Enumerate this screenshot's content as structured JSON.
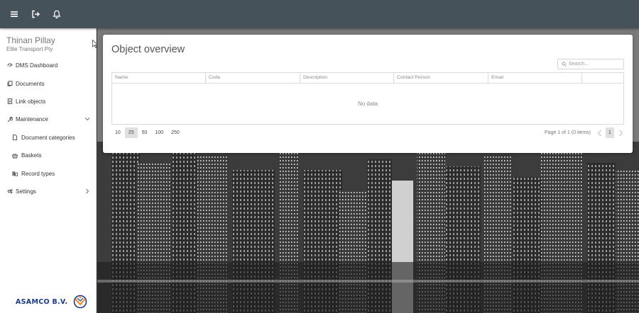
{
  "topbar": {
    "icons": [
      "menu-icon",
      "logout-icon",
      "bell-icon"
    ]
  },
  "user": {
    "name": "Thinan Pillay",
    "company": "Elite Transport Pty"
  },
  "nav": [
    {
      "label": "DMS Dashboard",
      "icon": "dashboard-icon"
    },
    {
      "label": "Documents",
      "icon": "documents-icon"
    },
    {
      "label": "Link objects",
      "icon": "link-objects-icon"
    },
    {
      "label": "Maintenance",
      "icon": "wrench-icon",
      "expanded": true
    },
    {
      "label": "Document categories",
      "icon": "file-icon",
      "sub": true
    },
    {
      "label": "Baskets",
      "icon": "basket-icon",
      "sub": true
    },
    {
      "label": "Record types",
      "icon": "record-types-icon",
      "sub": true
    },
    {
      "label": "Settings",
      "icon": "settings-icon",
      "expanded": false
    }
  ],
  "logo": {
    "text": "ASAMCO B.V."
  },
  "main": {
    "title": "Object overview",
    "search_placeholder": "Search...",
    "columns": [
      "Name",
      "Code",
      "Description",
      "Contact Person",
      "Email",
      ""
    ],
    "empty_text": "No data",
    "page_sizes": [
      "10",
      "25",
      "50",
      "100",
      "250"
    ],
    "active_page_size": "25",
    "page_info": "Page 1 of 1 (0 items)",
    "current_page": "1"
  },
  "colors": {
    "topbar": "#46525a",
    "sidebar": "#ffffff",
    "logo_text": "#1a3a8c",
    "logo_accent": "#f28c28"
  }
}
